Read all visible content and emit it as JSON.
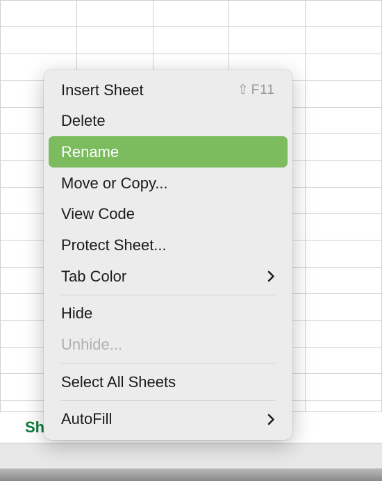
{
  "sheetTab": {
    "label": "Sh"
  },
  "contextMenu": {
    "items": [
      {
        "label": "Insert Sheet",
        "shortcut": "F11",
        "shortcutShift": true,
        "type": "item"
      },
      {
        "label": "Delete",
        "type": "item"
      },
      {
        "label": "Rename",
        "type": "item",
        "highlighted": true
      },
      {
        "label": "Move or Copy...",
        "type": "item"
      },
      {
        "label": "View Code",
        "type": "item"
      },
      {
        "label": "Protect Sheet...",
        "type": "item"
      },
      {
        "label": "Tab Color",
        "type": "submenu"
      },
      {
        "type": "divider"
      },
      {
        "label": "Hide",
        "type": "item"
      },
      {
        "label": "Unhide...",
        "type": "item",
        "disabled": true
      },
      {
        "type": "divider"
      },
      {
        "label": "Select All Sheets",
        "type": "item"
      },
      {
        "type": "divider"
      },
      {
        "label": "AutoFill",
        "type": "submenu"
      }
    ]
  }
}
